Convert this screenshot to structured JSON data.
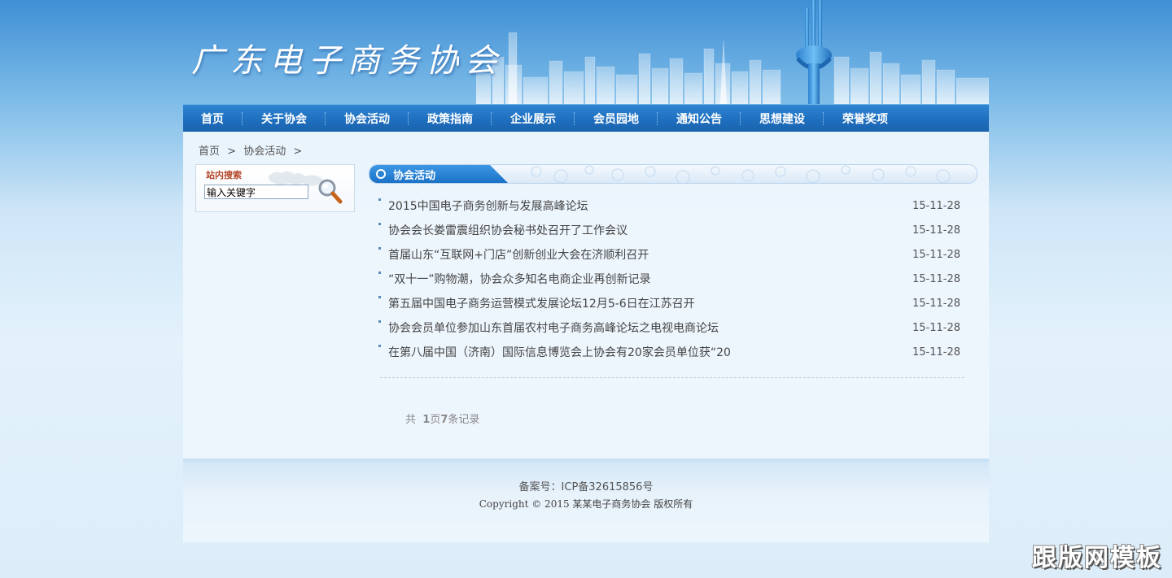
{
  "header": {
    "logo_text": "广东电子商务协会"
  },
  "nav": {
    "items": [
      {
        "label": "首页"
      },
      {
        "label": "关于协会"
      },
      {
        "label": "协会活动"
      },
      {
        "label": "政策指南"
      },
      {
        "label": "企业展示"
      },
      {
        "label": "会员园地"
      },
      {
        "label": "通知公告"
      },
      {
        "label": "思想建设"
      },
      {
        "label": "荣誉奖项"
      }
    ]
  },
  "breadcrumb": {
    "home": "首页",
    "separator": ">",
    "current": "协会活动",
    "trailing_separator": ">"
  },
  "search": {
    "title": "站内搜索",
    "input_value": "输入关键字"
  },
  "section": {
    "title": "协会活动"
  },
  "news": [
    {
      "title": "2015中国电子商务创新与发展高峰论坛",
      "date": "15-11-28"
    },
    {
      "title": "协会会长娄雷震组织协会秘书处召开了工作会议",
      "date": "15-11-28"
    },
    {
      "title": "首届山东“互联网+门店”创新创业大会在济顺利召开",
      "date": "15-11-28"
    },
    {
      "title": "“双十一”购物潮，协会众多知名电商企业再创新记录",
      "date": "15-11-28"
    },
    {
      "title": "第五届中国电子商务运营模式发展论坛12月5-6日在江苏召开",
      "date": "15-11-28"
    },
    {
      "title": "协会会员单位参加山东首届农村电子商务高峰论坛之电视电商论坛",
      "date": "15-11-28"
    },
    {
      "title": "在第八届中国（济南）国际信息博览会上协会有20家会员单位获“20",
      "date": "15-11-28"
    }
  ],
  "pagination": {
    "prefix": "共",
    "pages": "1",
    "pages_unit": "页",
    "records": "7",
    "records_unit": "条记录"
  },
  "footer": {
    "icp": "备案号：ICP备32615856号",
    "copyright": "Copyright © 2015 某某电子商务协会 版权所有"
  },
  "watermark": {
    "text": "跟版网模板"
  },
  "colors": {
    "nav_blue": "#1f6fbf",
    "accent_blue": "#2b82d4",
    "search_title": "#b4462a",
    "panel_bg": "#eef6fd"
  }
}
